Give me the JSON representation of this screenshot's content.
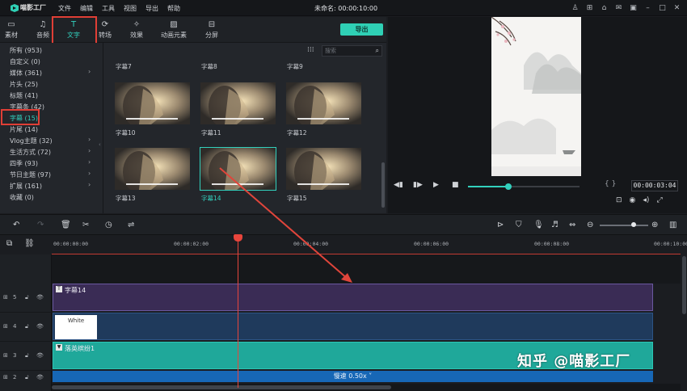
{
  "app": {
    "name": "喵影工厂",
    "menu": [
      "文件",
      "编辑",
      "工具",
      "视图",
      "导出",
      "帮助"
    ],
    "document_title": "未命名: 00:00:10:00"
  },
  "tabs": [
    {
      "label": "素材",
      "icon": "folder-icon"
    },
    {
      "label": "音频",
      "icon": "music-note-icon"
    },
    {
      "label": "文字",
      "icon": "text-icon",
      "active": true
    },
    {
      "label": "转场",
      "icon": "transition-icon"
    },
    {
      "label": "效果",
      "icon": "effects-icon"
    },
    {
      "label": "动画元素",
      "icon": "image-icon"
    },
    {
      "label": "分屏",
      "icon": "split-screen-icon"
    }
  ],
  "export_label": "导出",
  "categories": [
    {
      "label": "所有 (953)",
      "arrow": false
    },
    {
      "label": "自定义 (0)",
      "arrow": false
    },
    {
      "label": "媒体 (361)",
      "arrow": true
    },
    {
      "label": "片头 (25)",
      "arrow": false
    },
    {
      "label": "标题 (41)",
      "arrow": false
    },
    {
      "label": "字幕条 (42)",
      "arrow": false
    },
    {
      "label": "字幕 (15)",
      "arrow": false,
      "active": true
    },
    {
      "label": "片尾 (14)",
      "arrow": false
    },
    {
      "label": "Vlog主题 (32)",
      "arrow": true
    },
    {
      "label": "生活方式 (72)",
      "arrow": true
    },
    {
      "label": "四季 (93)",
      "arrow": true
    },
    {
      "label": "节日主题 (97)",
      "arrow": true
    },
    {
      "label": "扩展 (161)",
      "arrow": true
    },
    {
      "label": "收藏 (0)",
      "arrow": false
    }
  ],
  "search": {
    "placeholder": "搜索"
  },
  "grid_top_labels": [
    "字幕7",
    "字幕8",
    "字幕9"
  ],
  "tiles": [
    {
      "label": "字幕10"
    },
    {
      "label": "字幕11"
    },
    {
      "label": "字幕12"
    },
    {
      "label": "字幕13"
    },
    {
      "label": "字幕14",
      "active": true
    },
    {
      "label": "字幕15"
    }
  ],
  "preview": {
    "timecode": "00:00:03:04",
    "braces": "{ }",
    "progress": 0.36
  },
  "timeline": {
    "ruler": [
      "00:00:00:00",
      "00:00:02:00",
      "00:00:04:00",
      "00:00:06:00",
      "00:00:08:00",
      "00:00:10:00"
    ],
    "tracks": [
      "5",
      "4",
      "3",
      "2"
    ],
    "clips": {
      "title_clip": "字幕14",
      "color_clip": "White",
      "music_clip": "落英缤纷1",
      "speed_label": "慢速 0.50x ˅"
    },
    "zoom_level": 0.7
  },
  "watermark": "知乎 @喵影工厂",
  "colors": {
    "accent": "#32d0bd",
    "highlight": "#e03f36",
    "title_clip": "#3a2c55",
    "music_clip": "#1fa89a",
    "speed_bar": "#1767b6"
  }
}
